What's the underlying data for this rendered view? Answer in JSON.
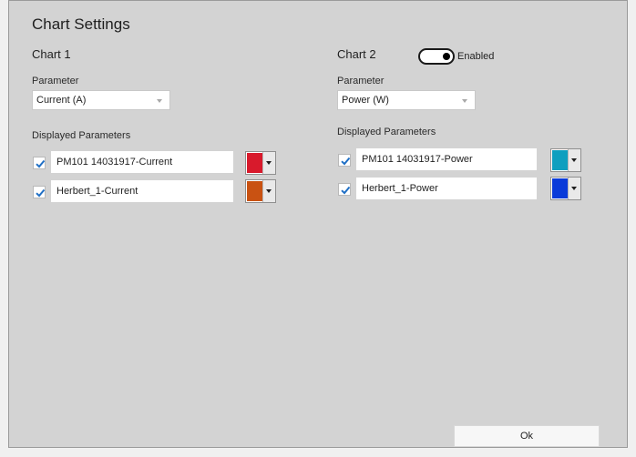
{
  "dialog": {
    "title": "Chart Settings",
    "ok_label": "Ok"
  },
  "chart1": {
    "title": "Chart 1",
    "parameter_label": "Parameter",
    "parameter_value": "Current (A)",
    "displayed_label": "Displayed Parameters",
    "items": [
      {
        "checked": true,
        "name": "PM101 14031917-Current",
        "color": "#d81a2c",
        "color_name": "red"
      },
      {
        "checked": true,
        "name": "Herbert_1-Current",
        "color": "#c95212",
        "color_name": "orange"
      }
    ]
  },
  "chart2": {
    "title": "Chart 2",
    "enabled_label": "Enabled",
    "enabled": true,
    "parameter_label": "Parameter",
    "parameter_value": "Power (W)",
    "displayed_label": "Displayed Parameters",
    "items": [
      {
        "checked": true,
        "name": "PM101 14031917-Power",
        "color": "#0f9fbf",
        "color_name": "teal"
      },
      {
        "checked": true,
        "name": "Herbert_1-Power",
        "color": "#0a3bd9",
        "color_name": "blue"
      }
    ]
  },
  "colors": {
    "window_bg": "#d3d3d3",
    "checkmark": "#1f6fc5"
  },
  "icons": {
    "checkmark": "check-icon",
    "dropdown": "chevron-down-icon"
  }
}
